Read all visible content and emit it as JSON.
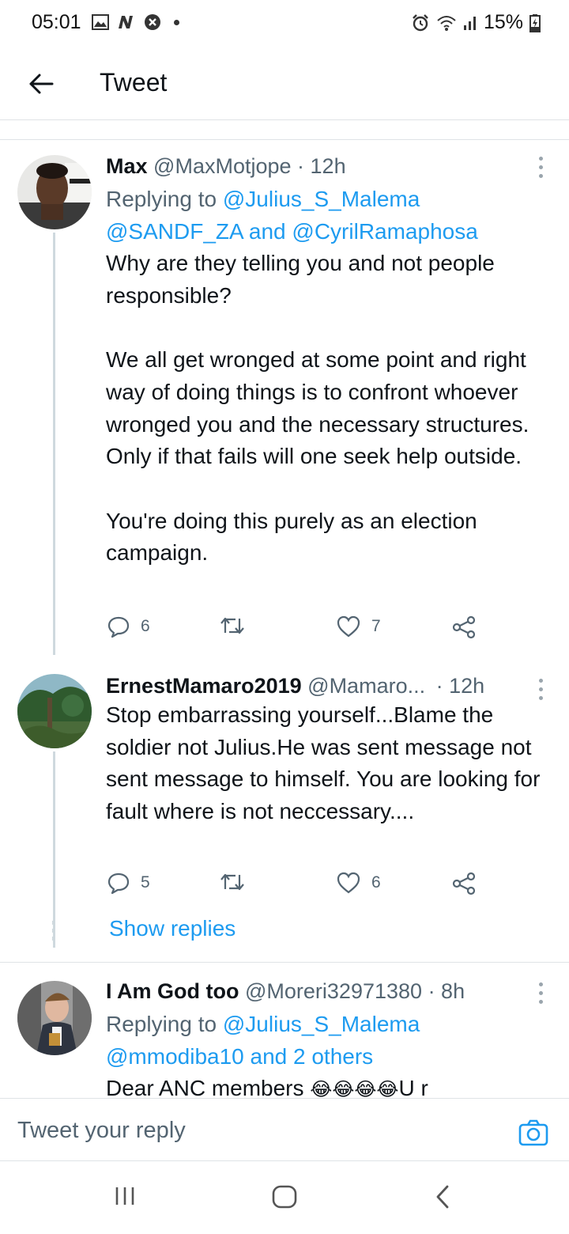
{
  "status_bar": {
    "time": "05:01",
    "battery": "15%",
    "icons_left": [
      "gallery-icon",
      "n-icon",
      "close-circle-icon",
      "dot"
    ],
    "icons_right": [
      "alarm-icon",
      "wifi-icon",
      "signal-icon",
      "battery-charging-icon"
    ]
  },
  "header": {
    "title": "Tweet"
  },
  "tweets": [
    {
      "name": "Max",
      "handle": "@MaxMotjope",
      "time": "· 12h",
      "replying_prefix": "Replying to ",
      "replying_first": "@Julius_S_Malema",
      "replying_rest": "@SANDF_ZA and @CyrilRamaphosa",
      "text": "Why are they telling you and not people responsible?\n\nWe all get wronged at some point and right way of doing things is to confront whoever wronged you and the necessary structures. Only if that fails will one seek help outside.\n\nYou're doing this purely as an election campaign.",
      "replies": "6",
      "retweets": "",
      "likes": "7"
    },
    {
      "name": "ErnestMamaro2019",
      "handle": "@Mamaro...",
      "time": "· 12h",
      "text": "Stop embarrassing yourself...Blame the soldier not Julius.He was sent message not sent message to himself. You are looking for fault where is not neccessary....",
      "replies": "5",
      "retweets": "",
      "likes": "6"
    },
    {
      "name": "I Am God too",
      "handle": "@Moreri32971380",
      "time": "· 8h",
      "replying_prefix": "Replying to ",
      "replying_first": "@Julius_S_Malema",
      "replying_rest": "@mmodiba10 and 2 others",
      "text_start": "Dear ANC members ",
      "emojis": "😂😂😂😂",
      "text_end": "U r"
    }
  ],
  "show_replies": "Show replies",
  "reply_bar": {
    "placeholder": "Tweet your reply"
  },
  "colors": {
    "link": "#1d9bf0",
    "secondary_text": "#536471",
    "primary_text": "#0f1419",
    "divider": "#dfe3e6"
  }
}
